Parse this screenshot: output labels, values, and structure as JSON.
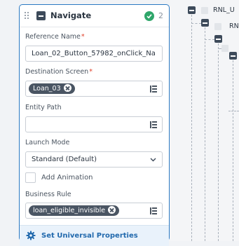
{
  "panel": {
    "title": "Navigate",
    "count": "2",
    "reference_name": {
      "label": "Reference Name",
      "required": "*",
      "value": "Loan_02_Button_57982_onClick_Na"
    },
    "destination_screen": {
      "label": "Destination Screen",
      "required": "*",
      "chip": "Loan_03"
    },
    "entity_path": {
      "label": "Entity Path",
      "value": ""
    },
    "launch_mode": {
      "label": "Launch Mode",
      "value": "Standard (Default)"
    },
    "add_animation": {
      "label": "Add Animation",
      "checked": false
    },
    "business_rule": {
      "label": "Business Rule",
      "chip": "loan_eligible_invisible"
    },
    "footer": {
      "label": "Set Universal Properties"
    }
  },
  "canvas": {
    "nodes": [
      {
        "label": "RNL_U"
      },
      {
        "label": "RN"
      }
    ]
  },
  "colors": {
    "accent": "#2b79c2",
    "success": "#2fa66a",
    "required": "#e0402a",
    "chip": "#4a5563"
  },
  "icons": [
    "drag-handle-icon",
    "collapse-icon",
    "check-circle-icon",
    "list-icon",
    "close-icon",
    "chevron-down-icon",
    "gear-icon"
  ]
}
